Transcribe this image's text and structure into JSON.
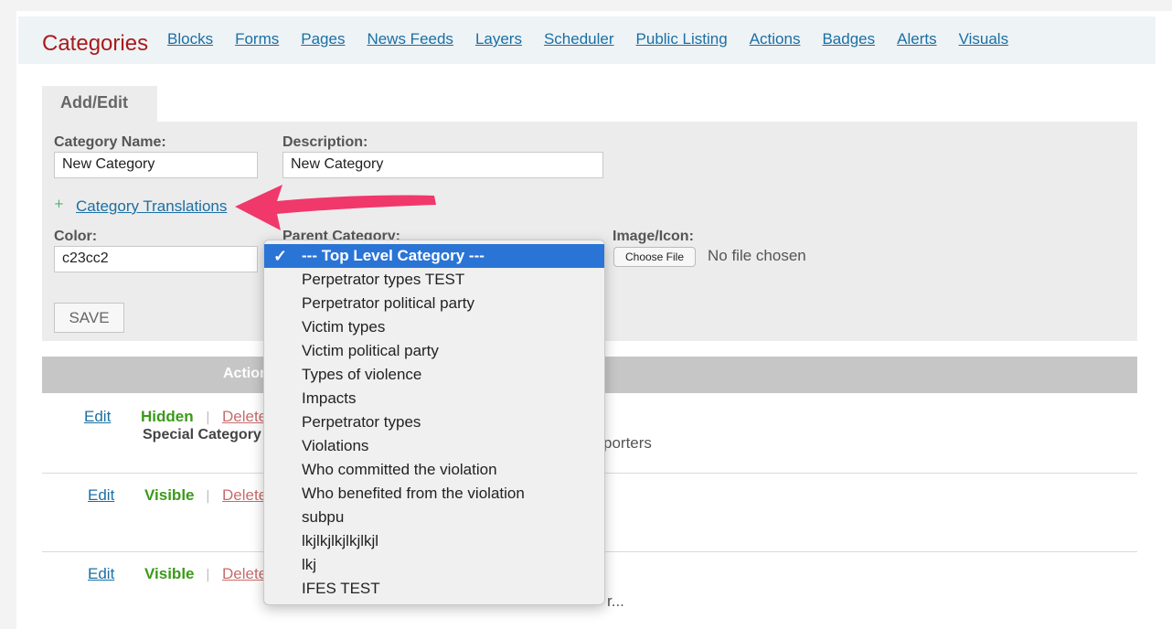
{
  "brand": "Categories",
  "nav": [
    "Blocks",
    "Forms",
    "Pages",
    "News Feeds",
    "Layers",
    "Scheduler",
    "Public Listing",
    "Actions",
    "Badges",
    "Alerts",
    "Visuals"
  ],
  "tab_label": "Add/Edit",
  "form": {
    "name_label": "Category Name:",
    "name_value": "New Category",
    "desc_label": "Description:",
    "desc_value": "New Category",
    "translations_label": "Category Translations",
    "plus": "+",
    "color_label": "Color:",
    "color_value": "c23cc2",
    "parent_label": "Parent Category:",
    "image_label": "Image/Icon:",
    "choose_file": "Choose File",
    "no_file": "No file chosen",
    "save": "SAVE"
  },
  "table": {
    "header": "Actions",
    "rows": [
      {
        "edit": "Edit",
        "status": "Hidden",
        "sep": "|",
        "delete": "Delete",
        "sub": "Special Category",
        "text": "porters"
      },
      {
        "edit": "Edit",
        "status": "Visible",
        "sep": "|",
        "delete": "Delete",
        "sub": "",
        "text": ""
      },
      {
        "edit": "Edit",
        "status": "Visible",
        "sep": "|",
        "delete": "Delete",
        "sub": "",
        "text": "r..."
      }
    ]
  },
  "dropdown": {
    "selected_index": 0,
    "check": "✓",
    "options": [
      "--- Top Level Category ---",
      "Perpetrator types TEST",
      "Perpetrator political party",
      "Victim types",
      "Victim political party",
      "Types of violence",
      "Impacts",
      "Perpetrator types",
      "Violations",
      "Who committed the violation",
      "Who benefited from the violation",
      "subpu",
      "lkjlkjlkjlkjlkjl",
      "lkj",
      "IFES TEST"
    ]
  },
  "colors": {
    "accent": "#2a74d6",
    "brand": "#a81b1b",
    "link": "#1b6fa3",
    "arrow": "#f0386b",
    "status": "#3a9a1a"
  }
}
